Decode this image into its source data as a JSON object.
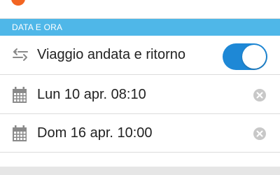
{
  "section": {
    "title": "DATA E ORA"
  },
  "round_trip": {
    "label": "Viaggio andata e ritorno",
    "enabled": true
  },
  "outbound": {
    "value": "Lun 10 apr. 08:10"
  },
  "return": {
    "value": "Dom 16 apr. 10:00"
  },
  "icons": {
    "swap": "swap-arrows-icon",
    "calendar": "calendar-icon",
    "clear": "clear-x-icon"
  },
  "colors": {
    "accent_orange": "#f26522",
    "section_blue": "#4fb7e8",
    "toggle_blue": "#1e88d6",
    "icon_gray": "#8a8a8a",
    "clear_gray": "#c8c8c8"
  }
}
